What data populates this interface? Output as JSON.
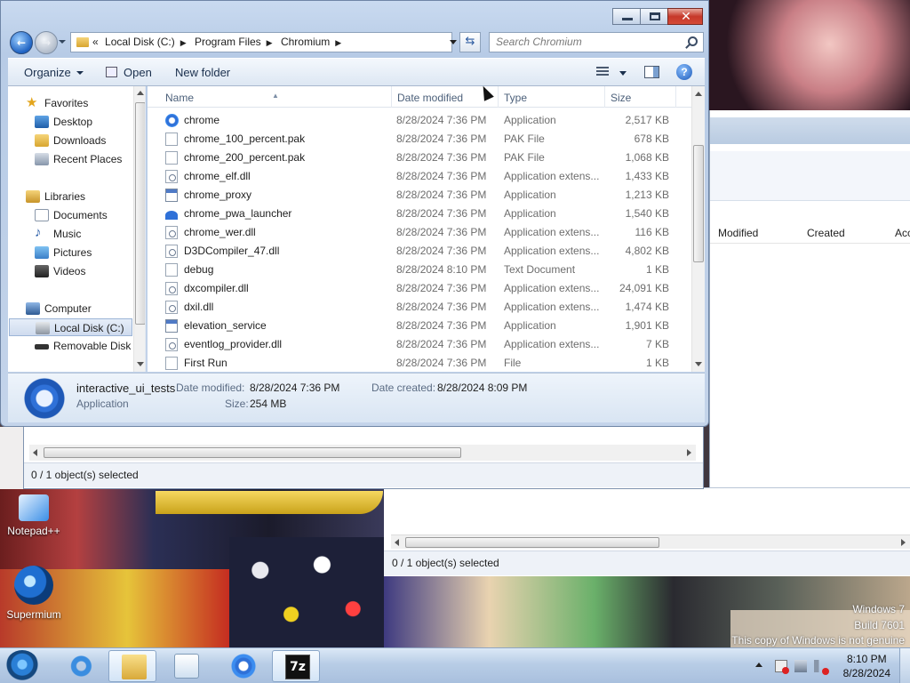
{
  "window": {
    "address": [
      "Local Disk (C:)",
      "Program Files",
      "Chromium"
    ],
    "address_prefix": "«",
    "search_placeholder": "Search Chromium"
  },
  "toolbar": {
    "organize": "Organize",
    "open": "Open",
    "new_folder": "New folder"
  },
  "nav": {
    "favorites": "Favorites",
    "desktop": "Desktop",
    "downloads": "Downloads",
    "recent_places": "Recent Places",
    "libraries": "Libraries",
    "documents": "Documents",
    "music": "Music",
    "pictures": "Pictures",
    "videos": "Videos",
    "computer": "Computer",
    "local_disk": "Local Disk (C:)",
    "removable_disk": "Removable Disk ("
  },
  "columns": {
    "name": "Name",
    "date_modified": "Date modified",
    "type": "Type",
    "size": "Size"
  },
  "files": [
    {
      "name": "chrome",
      "date": "8/28/2024 7:36 PM",
      "type": "Application",
      "size": "2,517 KB",
      "icon": "chrome-icon"
    },
    {
      "name": "chrome_100_percent.pak",
      "date": "8/28/2024 7:36 PM",
      "type": "PAK File",
      "size": "678 KB",
      "icon": "file-icon"
    },
    {
      "name": "chrome_200_percent.pak",
      "date": "8/28/2024 7:36 PM",
      "type": "PAK File",
      "size": "1,068 KB",
      "icon": "file-icon"
    },
    {
      "name": "chrome_elf.dll",
      "date": "8/28/2024 7:36 PM",
      "type": "Application extens...",
      "size": "1,433 KB",
      "icon": "dll-icon"
    },
    {
      "name": "chrome_proxy",
      "date": "8/28/2024 7:36 PM",
      "type": "Application",
      "size": "1,213 KB",
      "icon": "app-icon"
    },
    {
      "name": "chrome_pwa_launcher",
      "date": "8/28/2024 7:36 PM",
      "type": "Application",
      "size": "1,540 KB",
      "icon": "pwa-icon"
    },
    {
      "name": "chrome_wer.dll",
      "date": "8/28/2024 7:36 PM",
      "type": "Application extens...",
      "size": "116 KB",
      "icon": "dll-icon"
    },
    {
      "name": "D3DCompiler_47.dll",
      "date": "8/28/2024 7:36 PM",
      "type": "Application extens...",
      "size": "4,802 KB",
      "icon": "dll-icon"
    },
    {
      "name": "debug",
      "date": "8/28/2024 8:10 PM",
      "type": "Text Document",
      "size": "1 KB",
      "icon": "file-icon"
    },
    {
      "name": "dxcompiler.dll",
      "date": "8/28/2024 7:36 PM",
      "type": "Application extens...",
      "size": "24,091 KB",
      "icon": "dll-icon"
    },
    {
      "name": "dxil.dll",
      "date": "8/28/2024 7:36 PM",
      "type": "Application extens...",
      "size": "1,474 KB",
      "icon": "dll-icon"
    },
    {
      "name": "elevation_service",
      "date": "8/28/2024 7:36 PM",
      "type": "Application",
      "size": "1,901 KB",
      "icon": "app-icon"
    },
    {
      "name": "eventlog_provider.dll",
      "date": "8/28/2024 7:36 PM",
      "type": "Application extens...",
      "size": "7 KB",
      "icon": "dll-icon"
    },
    {
      "name": "First Run",
      "date": "8/28/2024 7:36 PM",
      "type": "File",
      "size": "1 KB",
      "icon": "file-icon"
    }
  ],
  "details": {
    "name": "interactive_ui_tests",
    "type": "Application",
    "modified_label": "Date modified:",
    "modified": "8/28/2024 7:36 PM",
    "created_label": "Date created:",
    "created": "8/28/2024 8:09 PM",
    "size_label": "Size:",
    "size": "254 MB"
  },
  "background": {
    "status_main": "0 / 1 object(s) selected",
    "status_second": "0 / 1 object(s) selected",
    "col_modified": "Modified",
    "col_created": "Created",
    "col_acc": "Acc"
  },
  "desktop": {
    "notepad": "Notepad++",
    "supermium": "Supermium",
    "watermark_line1": "Windows 7",
    "watermark_line2": "Build 7601",
    "watermark_line3": "This copy of Windows is not genuine"
  },
  "taskbar": {
    "time": "8:10 PM",
    "date": "8/28/2024",
    "sevenzip_label": "7z"
  }
}
